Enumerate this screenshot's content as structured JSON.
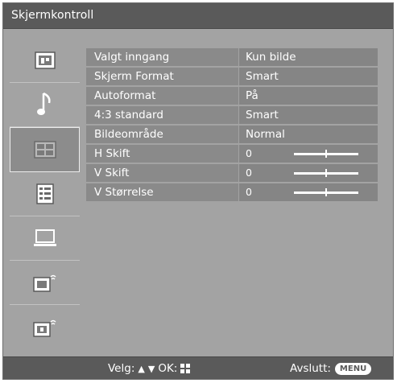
{
  "window": {
    "title": "Skjermkontroll"
  },
  "sidebar": {
    "items": [
      {
        "icon": "picture-icon",
        "active": false
      },
      {
        "icon": "music-note-icon",
        "active": false
      },
      {
        "icon": "screen-control-icon",
        "active": true
      },
      {
        "icon": "settings-list-icon",
        "active": false
      },
      {
        "icon": "monitor-icon",
        "active": false
      },
      {
        "icon": "channel-setup-icon",
        "active": false
      },
      {
        "icon": "digital-setup-icon",
        "active": false
      }
    ]
  },
  "settings": {
    "rows": [
      {
        "label": "Valgt inngang",
        "value": "Kun bilde"
      },
      {
        "label": "Skjerm Format",
        "value": "Smart"
      },
      {
        "label": "Autoformat",
        "value": "På"
      },
      {
        "label": "4:3 standard",
        "value": "Smart"
      },
      {
        "label": "Bildeområde",
        "value": "Normal"
      },
      {
        "label": "H Skift",
        "value": "0",
        "slider": 0.5
      },
      {
        "label": "V Skift",
        "value": "0",
        "slider": 0.5
      },
      {
        "label": "V Størrelse",
        "value": "0",
        "slider": 0.5
      }
    ]
  },
  "footer": {
    "select_label": "Velg:",
    "ok_label": "OK:",
    "exit_label": "Avslutt:",
    "menu_key": "MENU"
  },
  "colors": {
    "background": "#a3a3a3",
    "bar": "#5a5a5a",
    "row": "#8a8a8a",
    "text": "#ffffff"
  }
}
